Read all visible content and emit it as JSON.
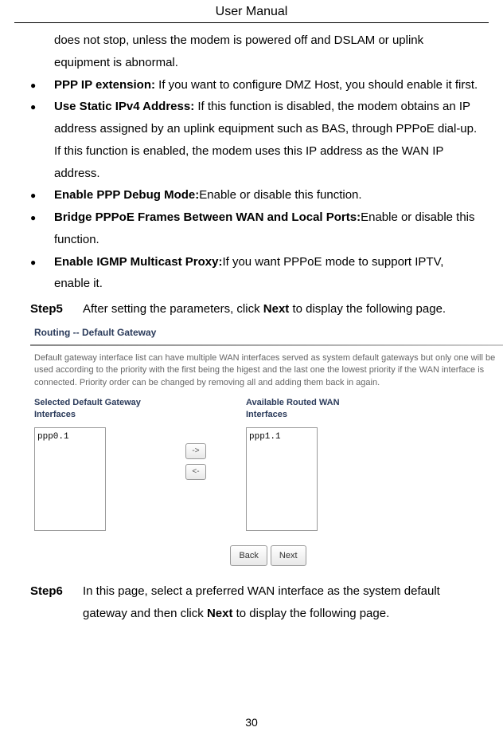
{
  "header": {
    "title": "User Manual"
  },
  "intro": {
    "text": "does not stop, unless the modem is powered off and DSLAM or uplink equipment is abnormal."
  },
  "bullets": [
    {
      "bold": "PPP IP extension:",
      "rest": " If you want to configure DMZ Host, you should enable it first."
    },
    {
      "bold": "Use Static IPv4 Address:",
      "rest": " If this function is disabled, the modem obtains an IP address assigned by an uplink equipment such as BAS, through PPPoE dial-up. If this function is enabled, the modem uses this IP address as the WAN IP address."
    },
    {
      "bold": "Enable PPP Debug Mode:",
      "rest": "Enable or disable this function."
    },
    {
      "bold": "Bridge PPPoE Frames Between WAN and Local Ports:",
      "rest": "Enable or disable this function."
    },
    {
      "bold": "Enable IGMP Multicast Proxy:",
      "rest": "If you want PPPoE mode to support IPTV, enable it."
    }
  ],
  "step5": {
    "label": "Step5",
    "pre": "After setting the parameters, click ",
    "bold": "Next",
    "post": " to display the following page."
  },
  "screenshot": {
    "title": "Routing -- Default Gateway",
    "desc": "Default gateway interface list can have multiple WAN interfaces served as system default gateways but only one will be used according to the priority with the first being the higest and the last one the lowest priority if the WAN interface is connected. Priority order can be changed by removing all and adding them back in again.",
    "left_label": "Selected Default Gateway Interfaces",
    "right_label": "Available Routed WAN Interfaces",
    "left_item": "ppp0.1",
    "right_item": "ppp1.1",
    "btn_right": "->",
    "btn_left": "<-",
    "back": "Back",
    "next": "Next"
  },
  "step6": {
    "label": "Step6",
    "pre": "In this page, select a preferred WAN interface as the system default gateway and then click ",
    "bold": "Next",
    "post": " to display the following page."
  },
  "page_num": "30"
}
